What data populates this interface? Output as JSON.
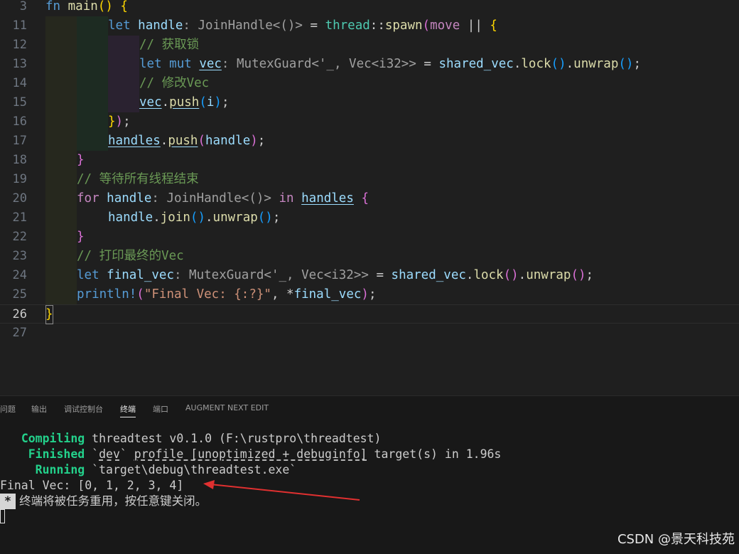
{
  "editor": {
    "lines": [
      {
        "n": "3"
      },
      {
        "n": "11"
      },
      {
        "n": "12"
      },
      {
        "n": "13"
      },
      {
        "n": "14"
      },
      {
        "n": "15"
      },
      {
        "n": "16"
      },
      {
        "n": "17"
      },
      {
        "n": "18"
      },
      {
        "n": "19"
      },
      {
        "n": "20"
      },
      {
        "n": "21"
      },
      {
        "n": "22"
      },
      {
        "n": "23"
      },
      {
        "n": "24"
      },
      {
        "n": "25"
      },
      {
        "n": "26"
      },
      {
        "n": "27"
      }
    ],
    "t": {
      "l3_fn": "fn",
      "l3_main": "main",
      "l3_paren": "()",
      "l3_brace": "{",
      "l11_let": "let",
      "l11_handle": "handle",
      "l11_hint": ": JoinHandle<()>",
      "l11_eq": " = ",
      "l11_thread": "thread",
      "l11_colons": "::",
      "l11_spawn": "spawn",
      "l11_open": "(",
      "l11_move": "move",
      "l11_bars": " || ",
      "l11_brace": "{",
      "l12_comment": "// 获取锁",
      "l13_let": "let",
      "l13_mut": "mut",
      "l13_vec": "vec",
      "l13_hint": ": MutexGuard<'_, Vec<i32>>",
      "l13_eq": " = ",
      "l13_shared": "shared_vec",
      "l13_dot1": ".",
      "l13_lock": "lock",
      "l13_p1": "()",
      "l13_dot2": ".",
      "l13_unwrap": "unwrap",
      "l13_p2": "()",
      "l13_semi": ";",
      "l14_comment": "// 修改Vec",
      "l15_vec": "vec",
      "l15_dot": ".",
      "l15_push": "push",
      "l15_open": "(",
      "l15_i": "i",
      "l15_close": ")",
      "l15_semi": ";",
      "l16_brace": "}",
      "l16_close": ")",
      "l16_semi": ";",
      "l17_handles": "handles",
      "l17_dot": ".",
      "l17_push": "push",
      "l17_open": "(",
      "l17_handle": "handle",
      "l17_close": ")",
      "l17_semi": ";",
      "l18_brace": "}",
      "l19_comment": "// 等待所有线程结束",
      "l20_for": "for",
      "l20_handle": "handle",
      "l20_hint": ": JoinHandle<()>",
      "l20_in": "in",
      "l20_handles": "handles",
      "l20_brace": "{",
      "l21_handle": "handle",
      "l21_dot1": ".",
      "l21_join": "join",
      "l21_p1": "()",
      "l21_dot2": ".",
      "l21_unwrap": "unwrap",
      "l21_p2": "()",
      "l21_semi": ";",
      "l22_brace": "}",
      "l23_comment": "// 打印最终的Vec",
      "l24_let": "let",
      "l24_final": "final_vec",
      "l24_hint": ": MutexGuard<'_, Vec<i32>>",
      "l24_eq": " = ",
      "l24_shared": "shared_vec",
      "l24_dot1": ".",
      "l24_lock": "lock",
      "l24_p1": "()",
      "l24_dot2": ".",
      "l24_unwrap": "unwrap",
      "l24_p2": "()",
      "l24_semi": ";",
      "l25_mac": "println!",
      "l25_open": "(",
      "l25_str": "\"Final Vec: {:?}\"",
      "l25_comma": ", *",
      "l25_final": "final_vec",
      "l25_close": ")",
      "l25_semi": ";",
      "l26_brace": "}"
    }
  },
  "panel": {
    "tabs": [
      "问题",
      "输出",
      "调试控制台",
      "终端",
      "端口",
      "AUGMENT NEXT EDIT"
    ],
    "active_tab": "终端"
  },
  "terminal": {
    "compiling_label": "Compiling",
    "compiling_text": " threadtest v0.1.0 (F:\\rustpro\\threadtest)",
    "finished_label": "Finished",
    "finished_pre": " `",
    "finished_dev": "dev",
    "finished_mid": "` ",
    "finished_profile": "profile [unoptimized + debuginfo]",
    "finished_post": " target(s) in 1.96s",
    "running_label": "Running",
    "running_text": " `target\\debug\\threadtest.exe`",
    "output": "Final Vec: [0, 1, 2, 3, 4]",
    "star": "*",
    "reuse_msg": " 终端将被任务重用，按任意键关闭。"
  },
  "watermark": "CSDN @景天科技苑",
  "colors": {
    "background": "#1f1f1f",
    "keyword": "#569cd6",
    "control": "#c586c0",
    "function": "#dcdcaa",
    "variable": "#9cdcfe",
    "type": "#4ec9b0",
    "comment": "#6a9955",
    "string": "#ce9178",
    "cargo_green": "#23d18b",
    "arrow": "#e03030"
  }
}
